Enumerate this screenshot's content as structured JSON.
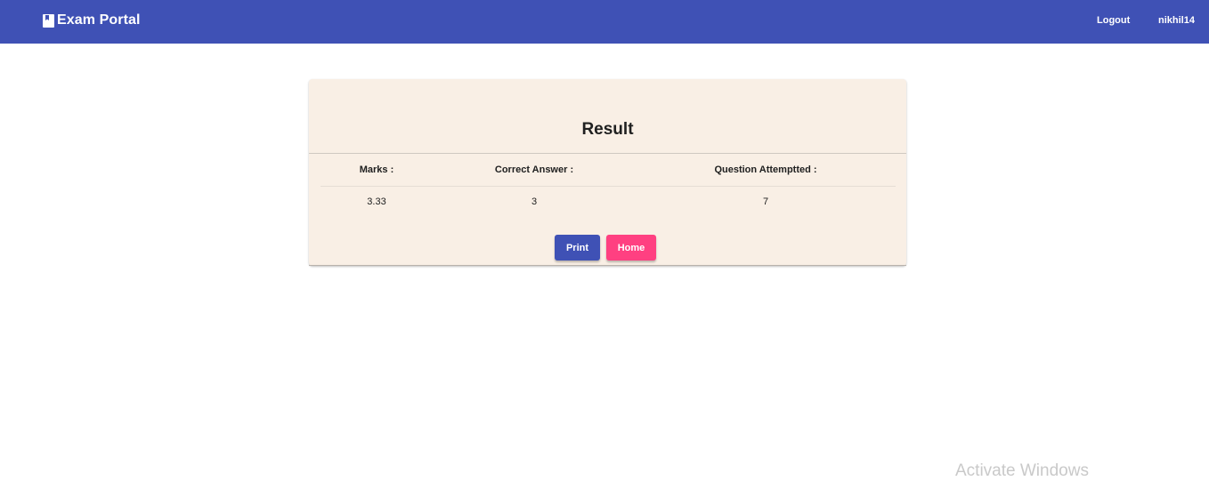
{
  "header": {
    "brand_title": "Exam Portal",
    "brand_icon": "book-icon",
    "nav": {
      "logout_label": "Logout",
      "username": "nikhil14"
    },
    "color": "#3f51b5"
  },
  "result_card": {
    "title": "Result",
    "columns": [
      "Marks :",
      "Correct Answer :",
      "Question Attemptted :"
    ],
    "values": [
      "3.33",
      "3",
      "7"
    ],
    "buttons": {
      "print_label": "Print",
      "home_label": "Home"
    },
    "colors": {
      "background": "#f9efe5",
      "print_button": "#3f51b5",
      "home_button": "#ff4081"
    }
  },
  "watermark": {
    "text": "Activate Windows"
  }
}
